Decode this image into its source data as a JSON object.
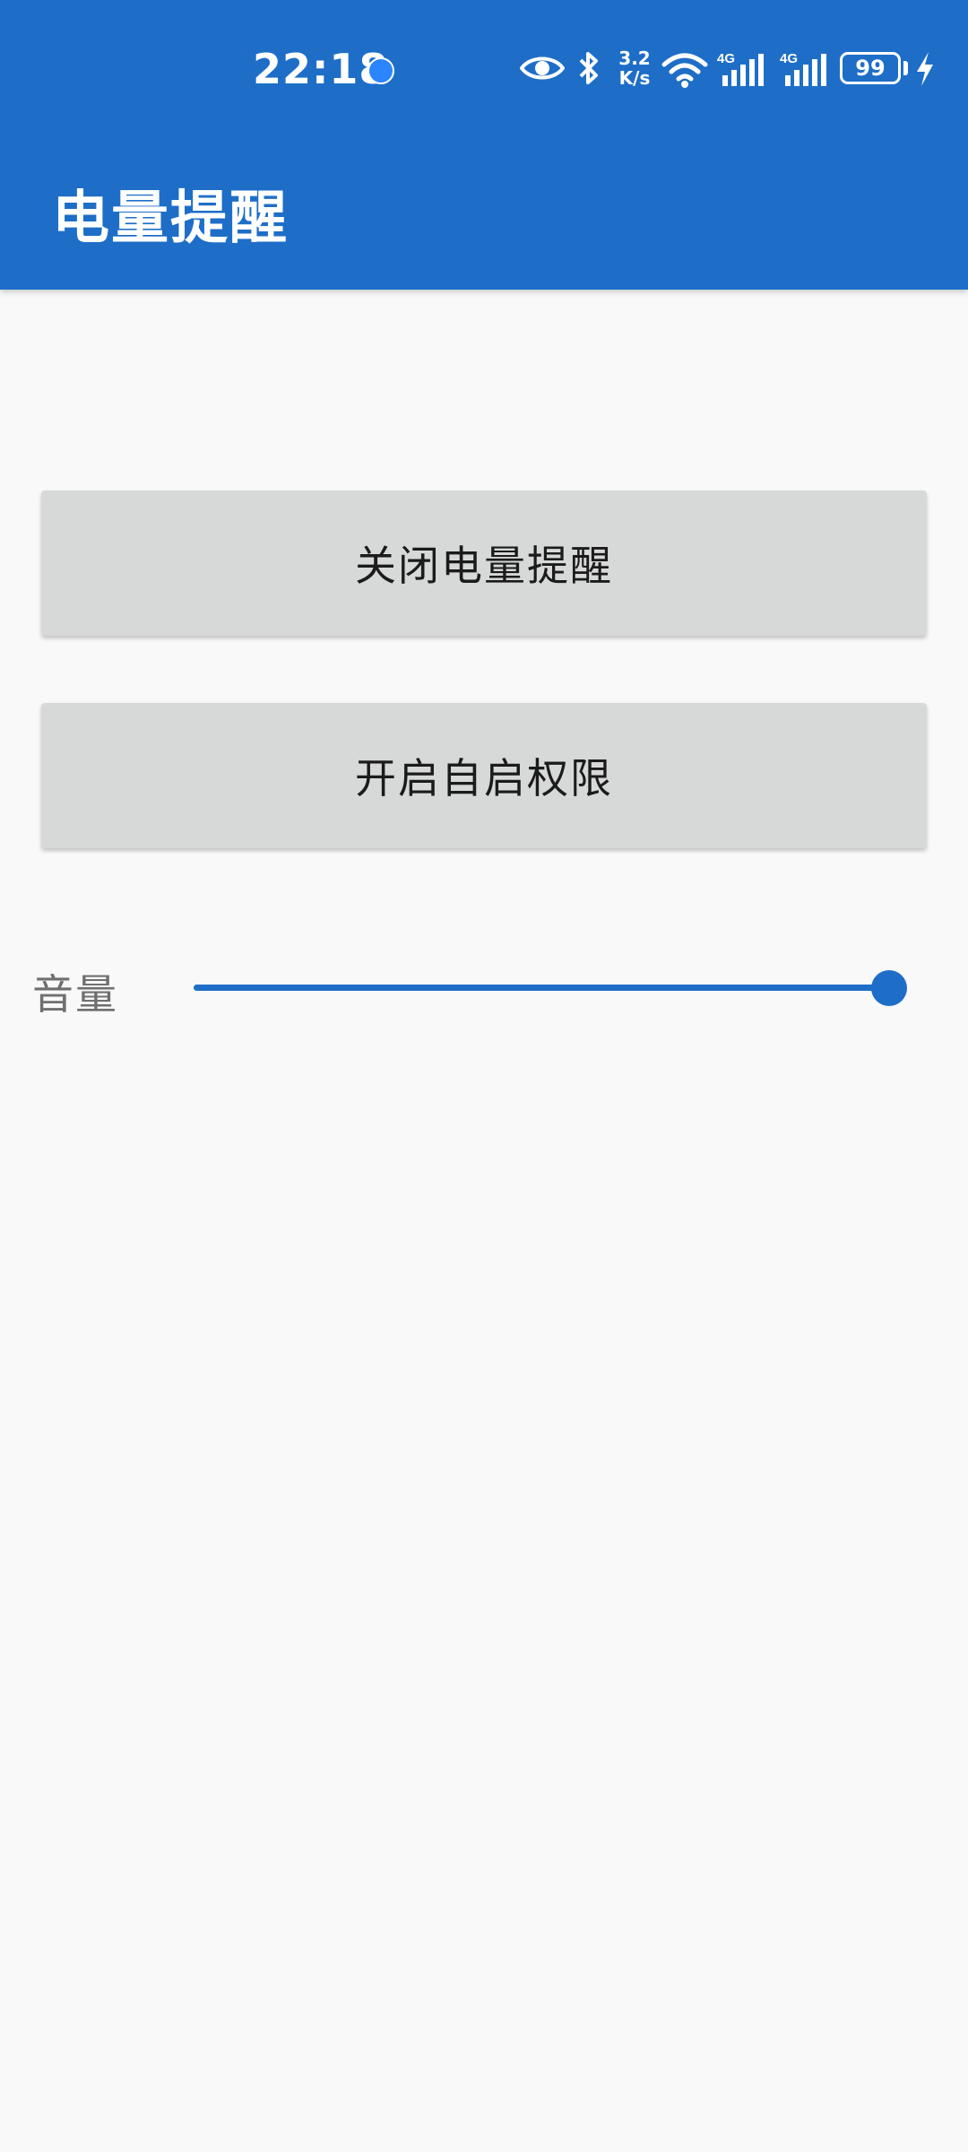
{
  "status_bar": {
    "time": "22:18",
    "network_speed_value": "3.2",
    "network_speed_unit": "K/s",
    "signal1_label": "4G",
    "signal2_label": "4G",
    "battery_level": "99",
    "icons": [
      "notification-bolt-icon",
      "eye-icon",
      "bluetooth-icon",
      "wifi-icon",
      "signal-icon",
      "signal-icon",
      "battery-icon",
      "charging-icon"
    ]
  },
  "app_bar": {
    "title": "电量提醒"
  },
  "main": {
    "buttons": [
      {
        "label": "关闭电量提醒"
      },
      {
        "label": "开启自启权限"
      }
    ],
    "volume": {
      "label": "音量",
      "value": 1.0
    }
  },
  "colors": {
    "primary": "#1e6ec8",
    "background": "#f9f9f9",
    "button_bg": "#d7d8d8",
    "button_text": "#1b1b1b",
    "label_text": "#6f6f6f"
  }
}
